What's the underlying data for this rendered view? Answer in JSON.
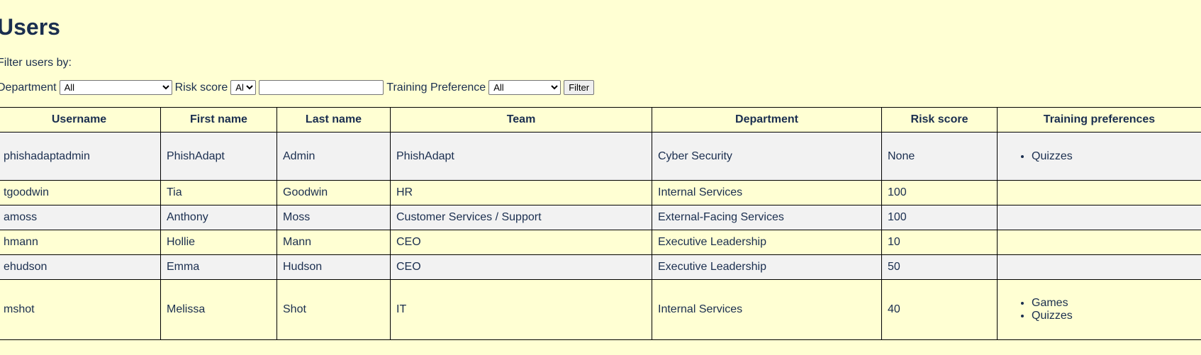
{
  "page": {
    "title": "Users",
    "filter_caption": "Filter users by:"
  },
  "filters": {
    "department_label": "Department",
    "department_value": "All",
    "risk_label": "Risk score",
    "risk_value": "All",
    "risk_input_value": "",
    "training_label": "Training Preference",
    "training_value": "All",
    "filter_button": "Filter"
  },
  "table": {
    "headers": [
      "Username",
      "First name",
      "Last name",
      "Team",
      "Department",
      "Risk score",
      "Training preferences"
    ],
    "rows": [
      {
        "username": "phishadaptadmin",
        "first_name": "PhishAdapt",
        "last_name": "Admin",
        "team": "PhishAdapt",
        "department": "Cyber Security",
        "risk_score": "None",
        "training": [
          "Quizzes"
        ]
      },
      {
        "username": "tgoodwin",
        "first_name": "Tia",
        "last_name": "Goodwin",
        "team": "HR",
        "department": "Internal Services",
        "risk_score": "100",
        "training": []
      },
      {
        "username": "amoss",
        "first_name": "Anthony",
        "last_name": "Moss",
        "team": "Customer Services / Support",
        "department": "External-Facing Services",
        "risk_score": "100",
        "training": []
      },
      {
        "username": "hmann",
        "first_name": "Hollie",
        "last_name": "Mann",
        "team": "CEO",
        "department": "Executive Leadership",
        "risk_score": "10",
        "training": []
      },
      {
        "username": "ehudson",
        "first_name": "Emma",
        "last_name": "Hudson",
        "team": "CEO",
        "department": "Executive Leadership",
        "risk_score": "50",
        "training": []
      },
      {
        "username": "mshot",
        "first_name": "Melissa",
        "last_name": "Shot",
        "team": "IT",
        "department": "Internal Services",
        "risk_score": "40",
        "training": [
          "Games",
          "Quizzes"
        ]
      }
    ]
  },
  "colors": {
    "background": "#ffffd3",
    "alt_row": "#f2f2f2",
    "text": "#1a2e4f"
  }
}
